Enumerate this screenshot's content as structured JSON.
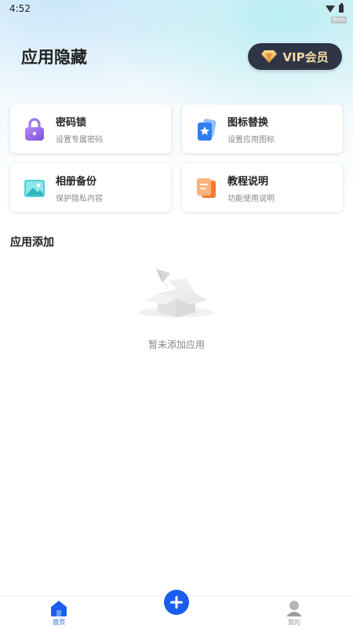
{
  "status_bar": {
    "time": "4:52",
    "tag": "Beta"
  },
  "header": {
    "title": "应用隐藏",
    "vip_label": "VIP会员"
  },
  "cards": [
    {
      "title": "密码锁",
      "subtitle": "设置专属密码",
      "icon": "lock-icon"
    },
    {
      "title": "图标替换",
      "subtitle": "设置应用图标",
      "icon": "star-card-icon"
    },
    {
      "title": "相册备份",
      "subtitle": "保护隐私内容",
      "icon": "image-icon"
    },
    {
      "title": "教程说明",
      "subtitle": "功能使用说明",
      "icon": "document-icon"
    }
  ],
  "section": {
    "title": "应用添加"
  },
  "empty_state": {
    "text": "暂未添加应用",
    "icon": "empty-box-icon"
  },
  "bottom_nav": {
    "home_label": "首页",
    "mine_label": "我的",
    "add_icon": "plus-icon"
  },
  "colors": {
    "accent": "#1a5ef0",
    "vip_bg": "#2f3447",
    "vip_text": "#f4d9a4"
  }
}
